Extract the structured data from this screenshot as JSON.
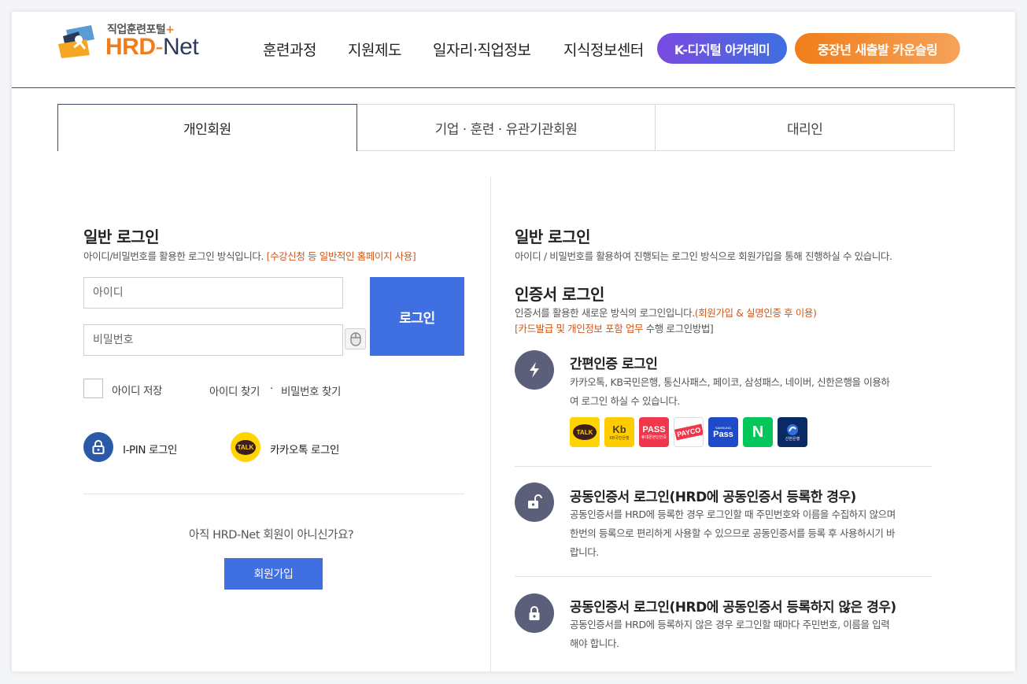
{
  "header": {
    "logo_sub": "직업훈련포털",
    "logo_plus": "+",
    "logo_hrd": "HRD",
    "logo_dash": "-",
    "logo_net": "Net",
    "nav": [
      "훈련과정",
      "지원제도",
      "일자리·직업정보",
      "지식정보센터"
    ],
    "pill_kdigital": "K-디지털 아카데미",
    "pill_counsel": "중장년 새출발 카운슬링",
    "colors": {
      "orange": "#f07d1a",
      "purple": "#7a4ae0",
      "blue": "#3f6fe0",
      "navy": "#2b3a5c"
    }
  },
  "tabs": [
    {
      "label": "개인회원",
      "active": true
    },
    {
      "label": "기업 · 훈련 · 유관기관회원",
      "active": false
    },
    {
      "label": "대리인",
      "active": false
    }
  ],
  "left": {
    "title": "일반 로그인",
    "desc": "아이디/비밀번호를 활용한 로그인 방식입니다.",
    "desc_highlight": "[수강신청 등 일반적인 홈페이지 사용]",
    "id_placeholder": "아이디",
    "pw_placeholder": "비밀번호",
    "login_button": "로그인",
    "keyboard_icon": "mouse-icon",
    "remember_label": "아이디 저장",
    "find_id": "아이디 찾기",
    "find_sep": "·",
    "find_pw": "비밀번호 찾기",
    "ipin_label": "I-PIN 로그인",
    "ipin_icon": "lock-icon",
    "kakao_label": "카카오톡 로그인",
    "kakao_icon_text": "TALK",
    "not_member": "아직 HRD-Net 회원이 아니신가요?",
    "join_button": "회원가입"
  },
  "right": {
    "general_title": "일반 로그인",
    "general_desc": "아이디 / 비밀번호를 활용하여 진행되는 로그인 방식으로 회원가입을 통해 진행하실 수 있습니다.",
    "cert_title": "인증서 로그인",
    "cert_desc": "인증서를 활용한 새로운 방식의 로그인입니다.",
    "cert_desc_hl1": "(회원가입 & 실명인증 후 이용)",
    "cert_desc_hl2": "[카드발급 및 개인정보 포함 업무",
    "cert_desc_tail": "수행 로그인방법]",
    "items": [
      {
        "title": "간편인증 로그인",
        "desc1": "카카오톡, KB국민은행, 통신사패스, 페이코, 삼성패스, 네이버, 신한은행을 이용하",
        "desc2": "여 로그인 하실 수 있습니다.",
        "icon": "lightning-icon"
      },
      {
        "title": "공동인증서 로그인(HRD에 공동인증서 등록한 경우)",
        "desc1": "공동인증서를 HRD에 등록한 경우 로그인할 때 주민번호와 이름을 수집하지 않으며",
        "desc2": "한번의 등록으로 편리하게 사용할 수 있으므로 공동인증서를 등록 후 사용하시기 바",
        "desc3": "랍니다.",
        "icon": "unlock-icon"
      },
      {
        "title": "공동인증서 로그인(HRD에 공동인증서 등록하지 않은 경우)",
        "desc1": "공동인증서를 HRD에 등록하지 않은 경우 로그인할 때마다 주민번호, 이름을 입력",
        "desc2": "해야 합니다.",
        "icon": "lock-icon"
      }
    ],
    "providers": {
      "kakao": "TALK",
      "kb_top": "Kb",
      "kb_bottom": "KB국민은행",
      "pass": "PASS",
      "pass_sub": "휴대폰본인인증",
      "payco": "PAYCO",
      "samsung_top": "SAMSUNG",
      "samsung": "Pass",
      "naver": "N",
      "shinhan": "신한은행"
    }
  }
}
